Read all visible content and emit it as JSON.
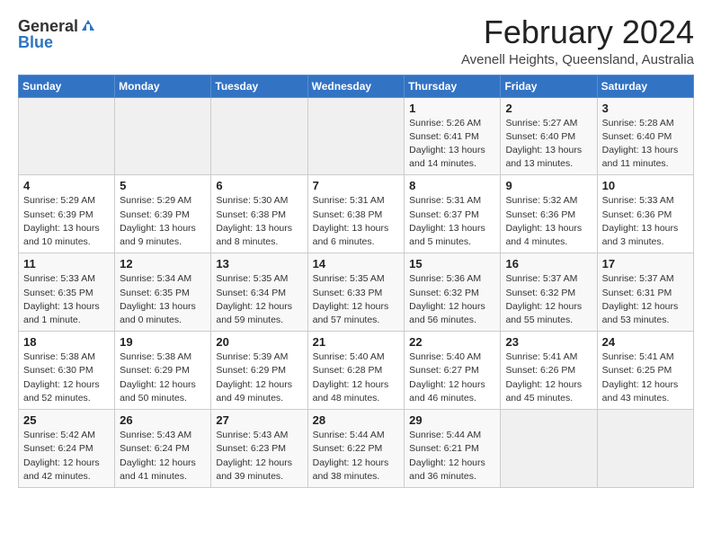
{
  "header": {
    "logo_general": "General",
    "logo_blue": "Blue",
    "month_title": "February 2024",
    "location": "Avenell Heights, Queensland, Australia"
  },
  "days_of_week": [
    "Sunday",
    "Monday",
    "Tuesday",
    "Wednesday",
    "Thursday",
    "Friday",
    "Saturday"
  ],
  "weeks": [
    [
      {
        "day": "",
        "info": ""
      },
      {
        "day": "",
        "info": ""
      },
      {
        "day": "",
        "info": ""
      },
      {
        "day": "",
        "info": ""
      },
      {
        "day": "1",
        "info": "Sunrise: 5:26 AM\nSunset: 6:41 PM\nDaylight: 13 hours\nand 14 minutes."
      },
      {
        "day": "2",
        "info": "Sunrise: 5:27 AM\nSunset: 6:40 PM\nDaylight: 13 hours\nand 13 minutes."
      },
      {
        "day": "3",
        "info": "Sunrise: 5:28 AM\nSunset: 6:40 PM\nDaylight: 13 hours\nand 11 minutes."
      }
    ],
    [
      {
        "day": "4",
        "info": "Sunrise: 5:29 AM\nSunset: 6:39 PM\nDaylight: 13 hours\nand 10 minutes."
      },
      {
        "day": "5",
        "info": "Sunrise: 5:29 AM\nSunset: 6:39 PM\nDaylight: 13 hours\nand 9 minutes."
      },
      {
        "day": "6",
        "info": "Sunrise: 5:30 AM\nSunset: 6:38 PM\nDaylight: 13 hours\nand 8 minutes."
      },
      {
        "day": "7",
        "info": "Sunrise: 5:31 AM\nSunset: 6:38 PM\nDaylight: 13 hours\nand 6 minutes."
      },
      {
        "day": "8",
        "info": "Sunrise: 5:31 AM\nSunset: 6:37 PM\nDaylight: 13 hours\nand 5 minutes."
      },
      {
        "day": "9",
        "info": "Sunrise: 5:32 AM\nSunset: 6:36 PM\nDaylight: 13 hours\nand 4 minutes."
      },
      {
        "day": "10",
        "info": "Sunrise: 5:33 AM\nSunset: 6:36 PM\nDaylight: 13 hours\nand 3 minutes."
      }
    ],
    [
      {
        "day": "11",
        "info": "Sunrise: 5:33 AM\nSunset: 6:35 PM\nDaylight: 13 hours\nand 1 minute."
      },
      {
        "day": "12",
        "info": "Sunrise: 5:34 AM\nSunset: 6:35 PM\nDaylight: 13 hours\nand 0 minutes."
      },
      {
        "day": "13",
        "info": "Sunrise: 5:35 AM\nSunset: 6:34 PM\nDaylight: 12 hours\nand 59 minutes."
      },
      {
        "day": "14",
        "info": "Sunrise: 5:35 AM\nSunset: 6:33 PM\nDaylight: 12 hours\nand 57 minutes."
      },
      {
        "day": "15",
        "info": "Sunrise: 5:36 AM\nSunset: 6:32 PM\nDaylight: 12 hours\nand 56 minutes."
      },
      {
        "day": "16",
        "info": "Sunrise: 5:37 AM\nSunset: 6:32 PM\nDaylight: 12 hours\nand 55 minutes."
      },
      {
        "day": "17",
        "info": "Sunrise: 5:37 AM\nSunset: 6:31 PM\nDaylight: 12 hours\nand 53 minutes."
      }
    ],
    [
      {
        "day": "18",
        "info": "Sunrise: 5:38 AM\nSunset: 6:30 PM\nDaylight: 12 hours\nand 52 minutes."
      },
      {
        "day": "19",
        "info": "Sunrise: 5:38 AM\nSunset: 6:29 PM\nDaylight: 12 hours\nand 50 minutes."
      },
      {
        "day": "20",
        "info": "Sunrise: 5:39 AM\nSunset: 6:29 PM\nDaylight: 12 hours\nand 49 minutes."
      },
      {
        "day": "21",
        "info": "Sunrise: 5:40 AM\nSunset: 6:28 PM\nDaylight: 12 hours\nand 48 minutes."
      },
      {
        "day": "22",
        "info": "Sunrise: 5:40 AM\nSunset: 6:27 PM\nDaylight: 12 hours\nand 46 minutes."
      },
      {
        "day": "23",
        "info": "Sunrise: 5:41 AM\nSunset: 6:26 PM\nDaylight: 12 hours\nand 45 minutes."
      },
      {
        "day": "24",
        "info": "Sunrise: 5:41 AM\nSunset: 6:25 PM\nDaylight: 12 hours\nand 43 minutes."
      }
    ],
    [
      {
        "day": "25",
        "info": "Sunrise: 5:42 AM\nSunset: 6:24 PM\nDaylight: 12 hours\nand 42 minutes."
      },
      {
        "day": "26",
        "info": "Sunrise: 5:43 AM\nSunset: 6:24 PM\nDaylight: 12 hours\nand 41 minutes."
      },
      {
        "day": "27",
        "info": "Sunrise: 5:43 AM\nSunset: 6:23 PM\nDaylight: 12 hours\nand 39 minutes."
      },
      {
        "day": "28",
        "info": "Sunrise: 5:44 AM\nSunset: 6:22 PM\nDaylight: 12 hours\nand 38 minutes."
      },
      {
        "day": "29",
        "info": "Sunrise: 5:44 AM\nSunset: 6:21 PM\nDaylight: 12 hours\nand 36 minutes."
      },
      {
        "day": "",
        "info": ""
      },
      {
        "day": "",
        "info": ""
      }
    ]
  ]
}
